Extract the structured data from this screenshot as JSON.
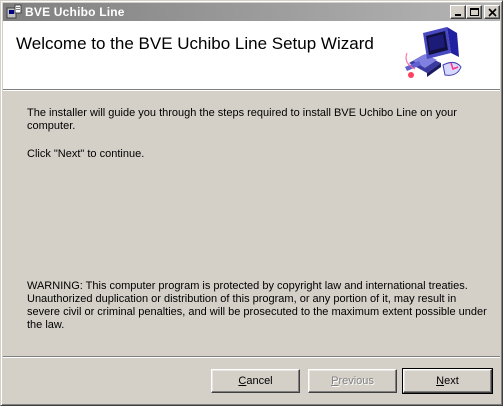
{
  "window": {
    "title": "BVE Uchibo Line",
    "icon": "installer-app-icon",
    "controls": [
      "minimize-icon",
      "maximize-icon",
      "close-icon"
    ]
  },
  "header": {
    "title": "Welcome to the BVE Uchibo Line Setup Wizard",
    "art": "computer-wizard-illustration"
  },
  "content": {
    "intro": "The installer will guide you through the steps required to install BVE Uchibo Line on your computer.",
    "continue_hint": "Click \"Next\" to continue.",
    "warning": "WARNING: This computer program is protected by copyright law and international treaties. Unauthorized duplication or distribution of this program, or any portion of it, may result in severe civil or criminal penalties, and will be prosecuted to the maximum extent possible under the law."
  },
  "buttons": {
    "cancel": {
      "first": "C",
      "rest": "ancel",
      "enabled": true
    },
    "previous": {
      "first": "P",
      "rest": "revious",
      "enabled": false
    },
    "next": {
      "first": "N",
      "rest": "ext",
      "enabled": true,
      "default": true
    }
  },
  "colors": {
    "dialog": "#d4d0c8",
    "title_inactive_start": "#808080",
    "title_inactive_end": "#b5b5b5",
    "header_bg": "#ffffff"
  }
}
